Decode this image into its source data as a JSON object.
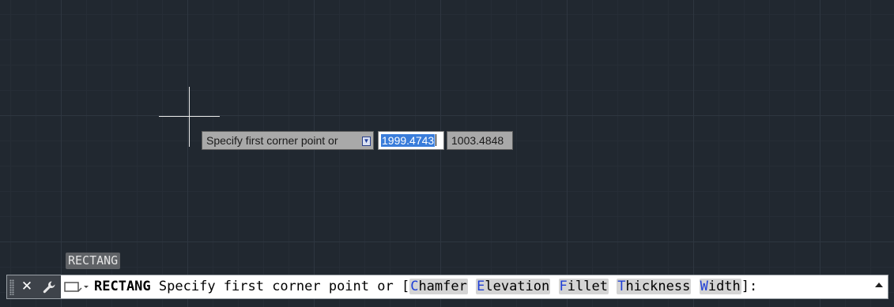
{
  "canvas": {
    "background_color": "#212830",
    "grid_major_color": "#2e3640",
    "grid_minor_color": "#262d36"
  },
  "dynamic_input": {
    "prompt": "Specify first corner point or",
    "x_value": "1999.4743",
    "y_value": "1003.4848",
    "options_icon": "down-arrow-icon"
  },
  "command_history": {
    "last": "RECTANG"
  },
  "command_line": {
    "close_glyph": "✕",
    "command": "RECTANG",
    "prompt": "Specify first corner point or [",
    "options": [
      {
        "key": "C",
        "rest": "hamfer"
      },
      {
        "key": "E",
        "rest": "levation"
      },
      {
        "key": "F",
        "rest": "illet"
      },
      {
        "key": "T",
        "rest": "hickness"
      },
      {
        "key": "W",
        "rest": "idth"
      }
    ],
    "suffix": "]:",
    "option_key_color": "#1f3fd6"
  }
}
